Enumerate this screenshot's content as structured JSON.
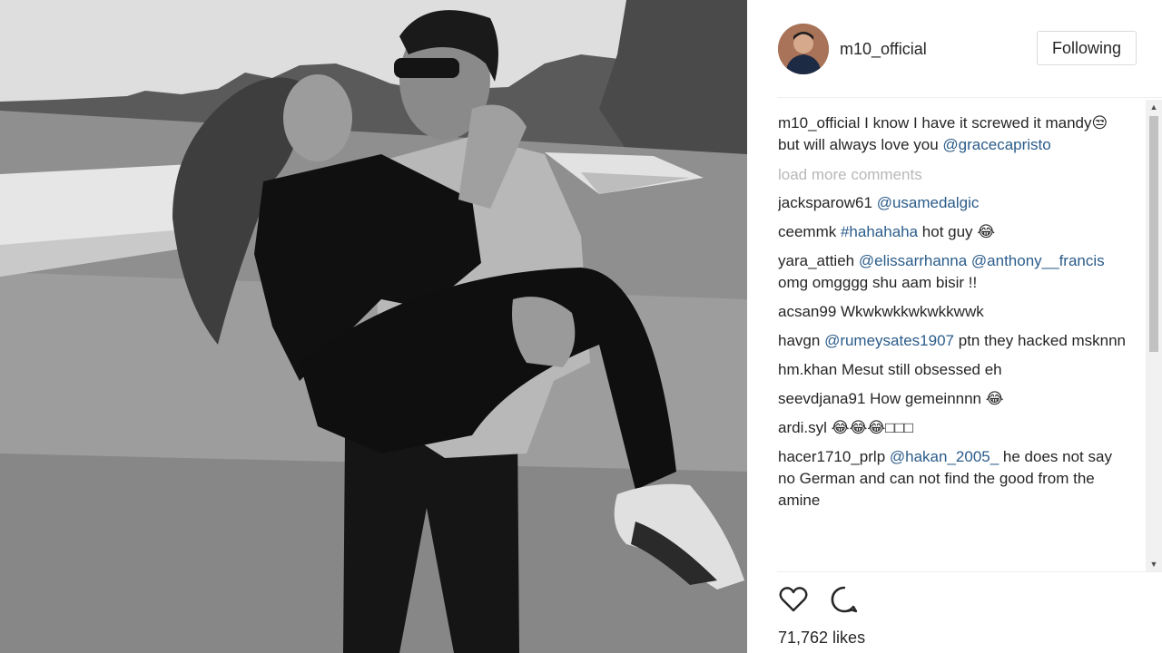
{
  "post": {
    "username": "m10_official",
    "follow_label": "Following",
    "caption": {
      "user": "m10_official",
      "text": " I know I have it screwed it mandy😒 but will always love you ",
      "mention": "@gracecapristo"
    },
    "load_more_label": "load more comments",
    "comments": [
      {
        "user": "jacksparow61",
        "parts": [
          {
            "mention": "@usamedalgic"
          }
        ]
      },
      {
        "user": "ceemmk",
        "parts": [
          {
            "mention": "#hahahaha"
          },
          {
            "text": " hot guy 😂"
          }
        ]
      },
      {
        "user": "yara_attieh",
        "parts": [
          {
            "mention": "@elissarrhanna"
          },
          {
            "text": " "
          },
          {
            "mention": "@anthony__francis"
          },
          {
            "text": " omg omgggg shu aam bisir !!"
          }
        ]
      },
      {
        "user": "acsan99",
        "parts": [
          {
            "text": "Wkwkwkkwkwkkwwk"
          }
        ]
      },
      {
        "user": "havgn",
        "parts": [
          {
            "mention": "@rumeysates1907"
          },
          {
            "text": " ptn they hacked msknnn"
          }
        ]
      },
      {
        "user": "hm.khan",
        "parts": [
          {
            "text": "Mesut still obsessed eh"
          }
        ]
      },
      {
        "user": "seevdjana91",
        "parts": [
          {
            "text": "How gemeinnnn 😂"
          }
        ]
      },
      {
        "user": "ardi.syl",
        "parts": [
          {
            "text": "😂😂😂□□□"
          }
        ]
      },
      {
        "user": "hacer1710_prlp",
        "parts": [
          {
            "mention": "@hakan_2005_"
          },
          {
            "text": " he does not say no German and can not find the good from the amine"
          }
        ]
      }
    ],
    "likes": "71,762 likes",
    "icons": {
      "like": "heart-icon",
      "comment": "comment-bubble-icon",
      "scroll_up": "scroll-up-arrow-icon",
      "scroll_down": "scroll-down-arrow-icon"
    },
    "colors": {
      "mention": "#2b5c8a",
      "muted": "#b8b8b8",
      "text": "#262626",
      "border": "#dbdbdb"
    }
  }
}
